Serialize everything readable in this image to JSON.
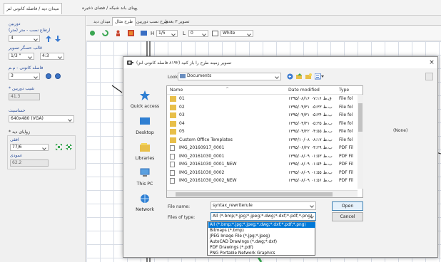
{
  "top_tabs": [
    "میدان دید / فاصله کانونی لنز",
    "پهنای باند شبکه / فضای ذخیره"
  ],
  "left_panel": {
    "group1_title": "دوربین",
    "mount_height_label": "ارتفاع نصب - متر (متر)",
    "mount_height_value": "4",
    "sensor_label": "قالب حسگر تصویر",
    "sensor_value": "1/3 \"",
    "aspect_value": "4:3",
    "focal_label": "فاصله کانونی - م.م",
    "focal_value": "3",
    "tilt_label": "* شیب دوربین",
    "tilt_value": "41.3",
    "resolution_label": "حساسیت",
    "resolution_value": "640x480 (VGA)",
    "view_angle_title": "* زوایای دید",
    "horizontal_label": "افقی",
    "horizontal_value": "77/6",
    "vertical_label": "عمودی",
    "vertical_value": "62.2"
  },
  "inner_tabs": [
    "میدان دید",
    "طرح مثال",
    "طرح نصب دوربین",
    "تصویر ۳ بعدی"
  ],
  "toolbar": {
    "h_label": "H",
    "h_value": "1/5",
    "l_label": "L",
    "l_value": "0",
    "color_value": "White"
  },
  "dialog": {
    "title": "تصویر زمینه طرح را باز کنید (۸۱۹۲ فاصله کانونی لنز)",
    "look_in_label": "Look in:",
    "look_in_value": "Documents",
    "columns": [
      "Name",
      "Date modified",
      "Type"
    ],
    "files": [
      {
        "name": "01",
        "date": "۱۳۹۵/۰۸/۱۶ ق.ظ ۰۷:۱۶",
        "type": "File fol",
        "kind": "folder"
      },
      {
        "name": "02",
        "date": "۱۳۹۵/۰۴/۳۱ ب.ظ ۰۵:۳۳",
        "type": "File fol",
        "kind": "folder"
      },
      {
        "name": "03",
        "date": "۱۳۹۵/۰۴/۳۱ ب.ظ ۰۵:۳۴",
        "type": "File fol",
        "kind": "folder"
      },
      {
        "name": "04",
        "date": "۱۳۹۵/۰۴/۳۱ ب.ظ ۰۵:۳۵",
        "type": "File fol",
        "kind": "folder"
      },
      {
        "name": "05",
        "date": "۱۳۹۵/۰۴/۲۲ ب.ظ ۰۴:۵۵",
        "type": "File fol",
        "kind": "folder"
      },
      {
        "name": "Custom Office Templates",
        "date": "۱۳۹۴/۱۰/۰۸ ب.ظ ۰۸:۱۷",
        "type": "File fol",
        "kind": "folder"
      },
      {
        "name": "IMG_20160917_0001",
        "date": "۱۳۹۵/۰۶/۲۷ ب.ظ ۰۴:۲۹",
        "type": "PDF Fil",
        "kind": "file"
      },
      {
        "name": "IMG_20161030_0001",
        "date": "۱۳۹۵/۰۸/۰۹ ب.ظ ۰۱:۵۳",
        "type": "PDF Fil",
        "kind": "file"
      },
      {
        "name": "IMG_20161030_0001_NEW",
        "date": "۱۳۹۵/۰۸/۰۹ ب.ظ ۰۱:۵۴",
        "type": "PDF Fil",
        "kind": "file"
      },
      {
        "name": "IMG_20161030_0002",
        "date": "۱۳۹۵/۰۸/۰۹ ب.ظ ۰۱:۵۵",
        "type": "PDF Fil",
        "kind": "file"
      },
      {
        "name": "IMG_20161030_0002_NEW",
        "date": "۱۳۹۵/۰۸/۰۹ ب.ظ ۰۱:۵۶",
        "type": "PDF Fil",
        "kind": "file"
      }
    ],
    "places": [
      "Quick access",
      "Desktop",
      "Libraries",
      "This PC",
      "Network"
    ],
    "preview_text": "(None)",
    "file_name_label": "File name:",
    "file_name_value": "syntax_rewriterule",
    "file_type_label": "Files of type:",
    "file_type_value": "All (*.bmp;*.jpg;*.jpeg;*.dwg;*.dxf;*.pdf;*.png)",
    "open_label": "Open",
    "cancel_label": "Cancel",
    "file_type_options": [
      "All (*.bmp;*.jpg;*.jpeg;*.dwg;*.dxf;*.pdf;*.png)",
      "Bitmaps (*.bmp)",
      "JPEG Image File (*.jpg;*.jpeg)",
      "AutoCAD Drawings (*.dwg;*.dxf)",
      "PDF Drawings (*.pdf)",
      "PNG Portable Network Graphics"
    ]
  },
  "colors": {
    "accent": "#0078d7",
    "folder": "#e8bf4a",
    "panel": "#f0f0f0"
  }
}
